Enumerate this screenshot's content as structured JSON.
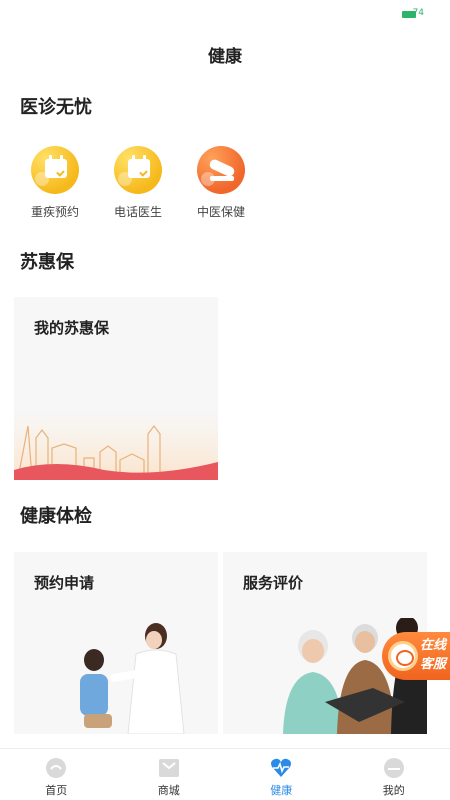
{
  "status_bar": {
    "battery_label": "74"
  },
  "header": {
    "title": "健康"
  },
  "sections": {
    "medical": {
      "title": "医诊无忧",
      "items": [
        {
          "label": "重疾预约",
          "icon": "calendar-check-icon"
        },
        {
          "label": "电话医生",
          "icon": "calendar-check-icon"
        },
        {
          "label": "中医保健",
          "icon": "bandage-icon"
        }
      ]
    },
    "suhuibao": {
      "title": "苏惠保",
      "card_title": "我的苏惠保"
    },
    "checkup": {
      "title": "健康体检",
      "cards": [
        {
          "title": "预约申请"
        },
        {
          "title": "服务评价"
        }
      ]
    }
  },
  "floating_service": {
    "line1": "在线",
    "line2": "客服"
  },
  "tabbar": {
    "items": [
      {
        "label": "首页",
        "icon": "home-icon"
      },
      {
        "label": "商城",
        "icon": "mall-icon"
      },
      {
        "label": "健康",
        "icon": "heart-pulse-icon",
        "active": true
      },
      {
        "label": "我的",
        "icon": "profile-icon"
      }
    ]
  },
  "colors": {
    "accent": "#2b8be8",
    "yellow": "#f6b91c",
    "orange": "#f0662b"
  }
}
